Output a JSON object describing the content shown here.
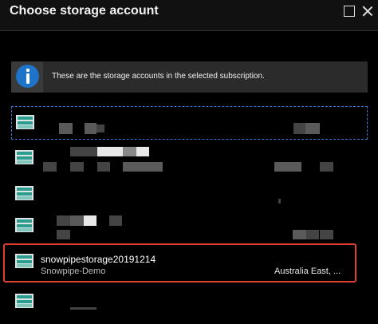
{
  "window": {
    "title": "Choose storage account",
    "maximize_icon": "maximize-icon",
    "close_icon": "close-icon"
  },
  "info_banner": {
    "icon": "info-icon",
    "icon_color": "#1e74c8",
    "text": "These are the storage accounts in the selected subscription."
  },
  "storage_accounts": [
    {
      "name": "",
      "resource_group": "",
      "location": "",
      "redacted": true,
      "focused": true
    },
    {
      "name": "",
      "resource_group": "",
      "location": "",
      "redacted": true
    },
    {
      "name": "",
      "resource_group": "",
      "location": "",
      "redacted": true
    },
    {
      "name": "",
      "resource_group": "",
      "location": "",
      "redacted": true
    },
    {
      "name": "snowpipestorage20191214",
      "resource_group": "Snowpipe-Demo",
      "location": "Australia East, ...",
      "selected": true
    },
    {
      "name": "",
      "resource_group": "",
      "location": "",
      "redacted": true
    }
  ],
  "selection_outline_color": "#e0402f"
}
